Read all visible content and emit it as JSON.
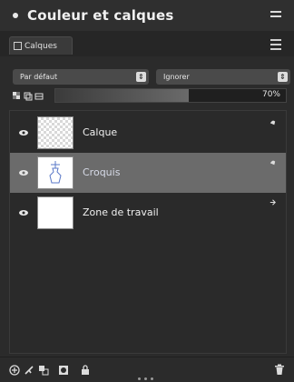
{
  "window": {
    "title": "Couleur et calques"
  },
  "tabs": [
    {
      "label": "Calques",
      "icon": "layers-icon"
    }
  ],
  "blend_mode": {
    "selected": "Par défaut"
  },
  "second_mode": {
    "selected": "Ignorer"
  },
  "opacity": {
    "value_text": "70%",
    "value": 0.7
  },
  "layers": [
    {
      "name": "Calque",
      "thumbnail": "transparent-checker",
      "selected": false
    },
    {
      "name": "Croquis",
      "thumbnail": "sketch-blue",
      "selected": true
    },
    {
      "name": "Zone de travail",
      "thumbnail": "white-canvas",
      "selected": false
    }
  ],
  "footer_icons": [
    "add-layer-icon",
    "brush-layer-icon",
    "merge-layers-icon",
    "mask-icon",
    "lock-icon",
    "trash-icon"
  ]
}
